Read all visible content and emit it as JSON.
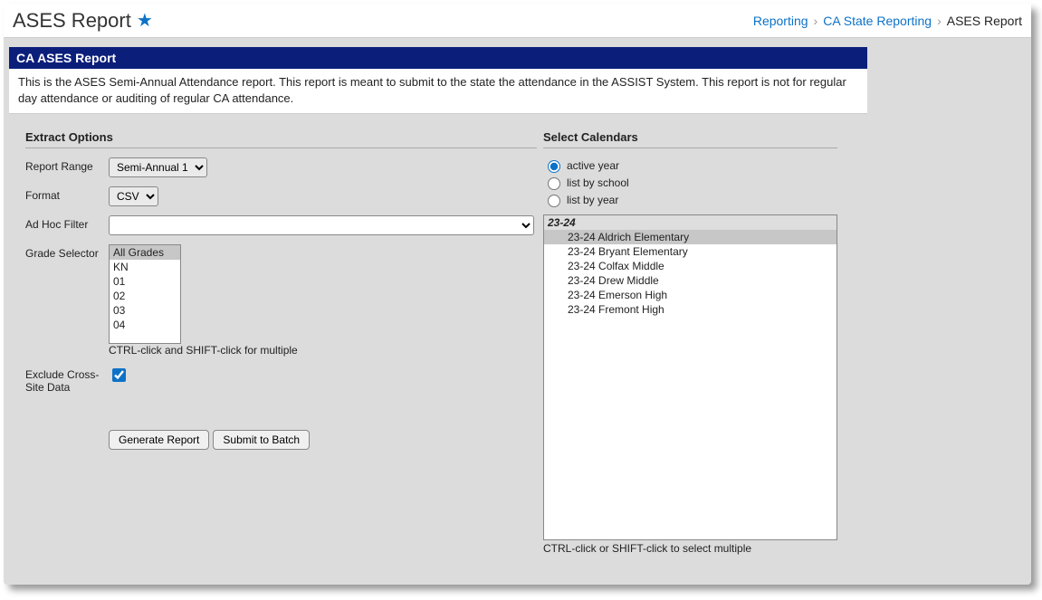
{
  "header": {
    "title": "ASES Report",
    "breadcrumbs": {
      "link1": "Reporting",
      "link2": "CA State Reporting",
      "current": "ASES Report"
    }
  },
  "panel": {
    "title": "CA ASES Report",
    "description": "This is the ASES Semi-Annual Attendance report. This report is meant to submit to the state the attendance in the ASSIST System. This report is not for regular day attendance or auditing of regular CA attendance."
  },
  "extract": {
    "section_title": "Extract Options",
    "report_range_label": "Report Range",
    "report_range_value": "Semi-Annual 1",
    "format_label": "Format",
    "format_value": "CSV",
    "adhoc_label": "Ad Hoc Filter",
    "adhoc_value": "",
    "grade_label": "Grade Selector",
    "grades": [
      "All Grades",
      "KN",
      "01",
      "02",
      "03",
      "04"
    ],
    "grade_selected": "All Grades",
    "grade_hint": "CTRL-click and SHIFT-click for multiple",
    "exclude_label": "Exclude Cross-Site Data",
    "exclude_checked": true,
    "generate_label": "Generate Report",
    "submit_label": "Submit to Batch"
  },
  "calendars": {
    "section_title": "Select Calendars",
    "radios": {
      "active": "active year",
      "school": "list by school",
      "year": "list by year"
    },
    "selected_radio": "active",
    "tree_root": "23-24",
    "tree_items": [
      "23-24 Aldrich Elementary",
      "23-24 Bryant Elementary",
      "23-24 Colfax Middle",
      "23-24 Drew Middle",
      "23-24 Emerson High",
      "23-24 Fremont High"
    ],
    "tree_selected": "23-24 Aldrich Elementary",
    "hint": "CTRL-click or SHIFT-click to select multiple"
  }
}
